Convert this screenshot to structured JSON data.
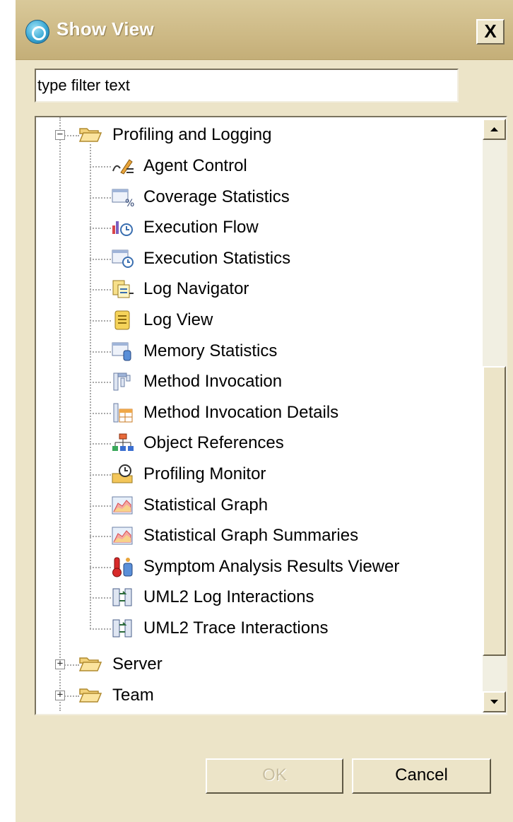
{
  "dialog": {
    "title": "Show View",
    "close_label": "X"
  },
  "filter": {
    "value": "type filter text"
  },
  "tree": {
    "category": {
      "label": "Profiling and Logging",
      "expanded": true,
      "children": [
        {
          "label": "Agent Control",
          "icon": "agent-control-icon"
        },
        {
          "label": "Coverage Statistics",
          "icon": "coverage-statistics-icon"
        },
        {
          "label": "Execution Flow",
          "icon": "execution-flow-icon"
        },
        {
          "label": "Execution Statistics",
          "icon": "execution-statistics-icon"
        },
        {
          "label": "Log Navigator",
          "icon": "log-navigator-icon"
        },
        {
          "label": "Log View",
          "icon": "log-view-icon"
        },
        {
          "label": "Memory Statistics",
          "icon": "memory-statistics-icon"
        },
        {
          "label": "Method Invocation",
          "icon": "method-invocation-icon"
        },
        {
          "label": "Method Invocation Details",
          "icon": "method-invocation-details-icon"
        },
        {
          "label": "Object References",
          "icon": "object-references-icon"
        },
        {
          "label": "Profiling Monitor",
          "icon": "profiling-monitor-icon"
        },
        {
          "label": "Statistical Graph",
          "icon": "statistical-graph-icon"
        },
        {
          "label": "Statistical Graph Summaries",
          "icon": "statistical-graph-summaries-icon"
        },
        {
          "label": "Symptom Analysis Results Viewer",
          "icon": "symptom-analysis-icon"
        },
        {
          "label": "UML2 Log Interactions",
          "icon": "uml2-log-interactions-icon"
        },
        {
          "label": "UML2 Trace Interactions",
          "icon": "uml2-trace-interactions-icon"
        }
      ]
    },
    "collapsed": [
      {
        "label": "Server"
      },
      {
        "label": "Team"
      }
    ]
  },
  "buttons": {
    "ok_label": "OK",
    "cancel_label": "Cancel"
  }
}
